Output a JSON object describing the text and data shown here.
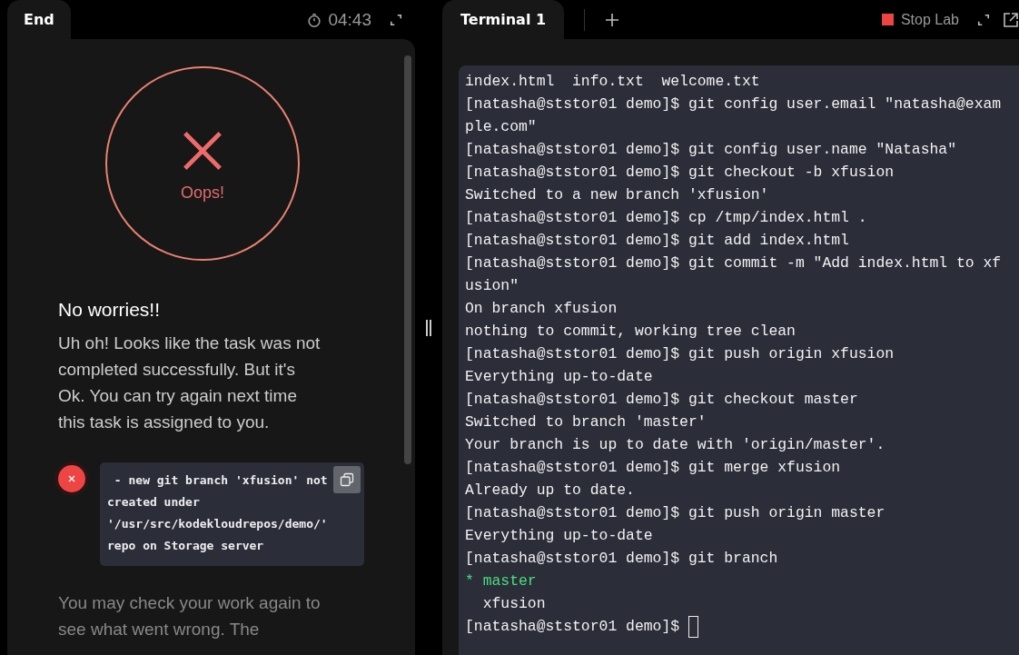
{
  "left_panel": {
    "tab": {
      "label": "End",
      "selected": true
    },
    "timer": "04:43",
    "result": {
      "label": "Oops!"
    },
    "heading": "No worries!!",
    "message": "Uh oh! Looks like the task was not completed successfully. But it's Ok. You can try again next time this task is assigned to you.",
    "failures": [
      {
        "text": " - new git branch 'xfusion' not created under '/usr/src/kodekloudrepos/demo/' repo on Storage server"
      }
    ],
    "footer_text": "You may check your work again to see what went wrong. The"
  },
  "terminal": {
    "tabs": [
      {
        "label": "Terminal 1",
        "selected": true
      }
    ],
    "stop_label": "Stop Lab",
    "lines": [
      {
        "kind": "output",
        "text": "index.html  info.txt  welcome.txt"
      },
      {
        "kind": "output",
        "text": "[natasha@ststor01 demo]$ git config user.email \"natasha@example.com\""
      },
      {
        "kind": "output",
        "text": "[natasha@ststor01 demo]$ git config user.name \"Natasha\""
      },
      {
        "kind": "output",
        "text": "[natasha@ststor01 demo]$ git checkout -b xfusion"
      },
      {
        "kind": "output",
        "text": "Switched to a new branch 'xfusion'"
      },
      {
        "kind": "output",
        "text": "[natasha@ststor01 demo]$ cp /tmp/index.html ."
      },
      {
        "kind": "output",
        "text": "[natasha@ststor01 demo]$ git add index.html"
      },
      {
        "kind": "output",
        "text": "[natasha@ststor01 demo]$ git commit -m \"Add index.html to xfusion\""
      },
      {
        "kind": "output",
        "text": "On branch xfusion"
      },
      {
        "kind": "output",
        "text": "nothing to commit, working tree clean"
      },
      {
        "kind": "output",
        "text": "[natasha@ststor01 demo]$ git push origin xfusion"
      },
      {
        "kind": "output",
        "text": "Everything up-to-date"
      },
      {
        "kind": "output",
        "text": "[natasha@ststor01 demo]$ git checkout master"
      },
      {
        "kind": "output",
        "text": "Switched to branch 'master'"
      },
      {
        "kind": "output",
        "text": "Your branch is up to date with 'origin/master'."
      },
      {
        "kind": "output",
        "text": "[natasha@ststor01 demo]$ git merge xfusion"
      },
      {
        "kind": "output",
        "text": "Already up to date."
      },
      {
        "kind": "output",
        "text": "[natasha@ststor01 demo]$ git push origin master"
      },
      {
        "kind": "output",
        "text": "Everything up-to-date"
      },
      {
        "kind": "output",
        "text": "[natasha@ststor01 demo]$ git branch"
      },
      {
        "kind": "current_branch",
        "text": "* master"
      },
      {
        "kind": "output",
        "text": "  xfusion"
      },
      {
        "kind": "prompt",
        "text": "[natasha@ststor01 demo]$ "
      }
    ]
  }
}
